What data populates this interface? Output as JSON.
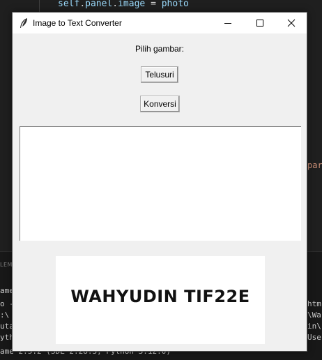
{
  "background_editor": {
    "code_line_top": {
      "object": "self",
      "dot1": ".",
      "attr1": "panel",
      "dot2": ".",
      "attr2": "image",
      "eq": " = ",
      "value": "photo"
    },
    "code_right_fragment": "par",
    "terminal_tab_fragment": "LEM",
    "terminal_left_lines": [
      "ame",
      "o -",
      ":\\",
      "uta",
      "yth",
      "ame 2.5.2 (SDL 2.28.3, Python 3.12.0)"
    ],
    "terminal_right_lines": [
      "htm",
      "\\Wa",
      "in\\",
      "Use"
    ]
  },
  "window": {
    "title": "Image to Text Converter",
    "controls": {
      "minimize": "minimize-icon",
      "maximize": "maximize-icon",
      "close": "close-icon"
    }
  },
  "form": {
    "prompt_label": "Pilih gambar:",
    "browse_button": "Telusuri",
    "convert_button": "Konversi"
  },
  "output_text": "",
  "image_preview": {
    "text": "WAHYUDIN TIF22E"
  },
  "colors": {
    "window_bg": "#f0f0f0",
    "titlebar_bg": "#ffffff",
    "editor_bg": "#1f1f1f",
    "code_variable": "#9cdcfe",
    "cursor_marker": "#e02020"
  }
}
